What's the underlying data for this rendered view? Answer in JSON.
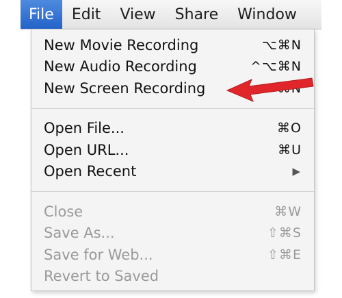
{
  "menubar": {
    "items": [
      {
        "label": "File",
        "active": true
      },
      {
        "label": "Edit",
        "active": false
      },
      {
        "label": "View",
        "active": false
      },
      {
        "label": "Share",
        "active": false
      },
      {
        "label": "Window",
        "active": false
      }
    ]
  },
  "file_menu": {
    "groups": [
      [
        {
          "label": "New Movie Recording",
          "shortcut": "⌥⌘N",
          "enabled": true
        },
        {
          "label": "New Audio Recording",
          "shortcut": "^⌥⌘N",
          "enabled": true
        },
        {
          "label": "New Screen Recording",
          "shortcut": "^⌘N",
          "enabled": true
        }
      ],
      [
        {
          "label": "Open File...",
          "shortcut": "⌘O",
          "enabled": true
        },
        {
          "label": "Open URL...",
          "shortcut": "⌘U",
          "enabled": true
        },
        {
          "label": "Open Recent",
          "shortcut": "▶",
          "enabled": true,
          "submenu": true
        }
      ],
      [
        {
          "label": "Close",
          "shortcut": "⌘W",
          "enabled": false
        },
        {
          "label": "Save As...",
          "shortcut": "⇧⌘S",
          "enabled": false
        },
        {
          "label": "Save for Web...",
          "shortcut": "⇧⌘E",
          "enabled": false
        },
        {
          "label": "Revert to Saved",
          "shortcut": "",
          "enabled": false
        }
      ]
    ]
  },
  "annotation": {
    "type": "red-arrow-icon",
    "color": "#e0262a",
    "points_to": "New Screen Recording"
  },
  "colors": {
    "menubar_active": "#2f6fd1",
    "menu_background": "#f4f4f4",
    "disabled_text": "#9a9a9a"
  }
}
